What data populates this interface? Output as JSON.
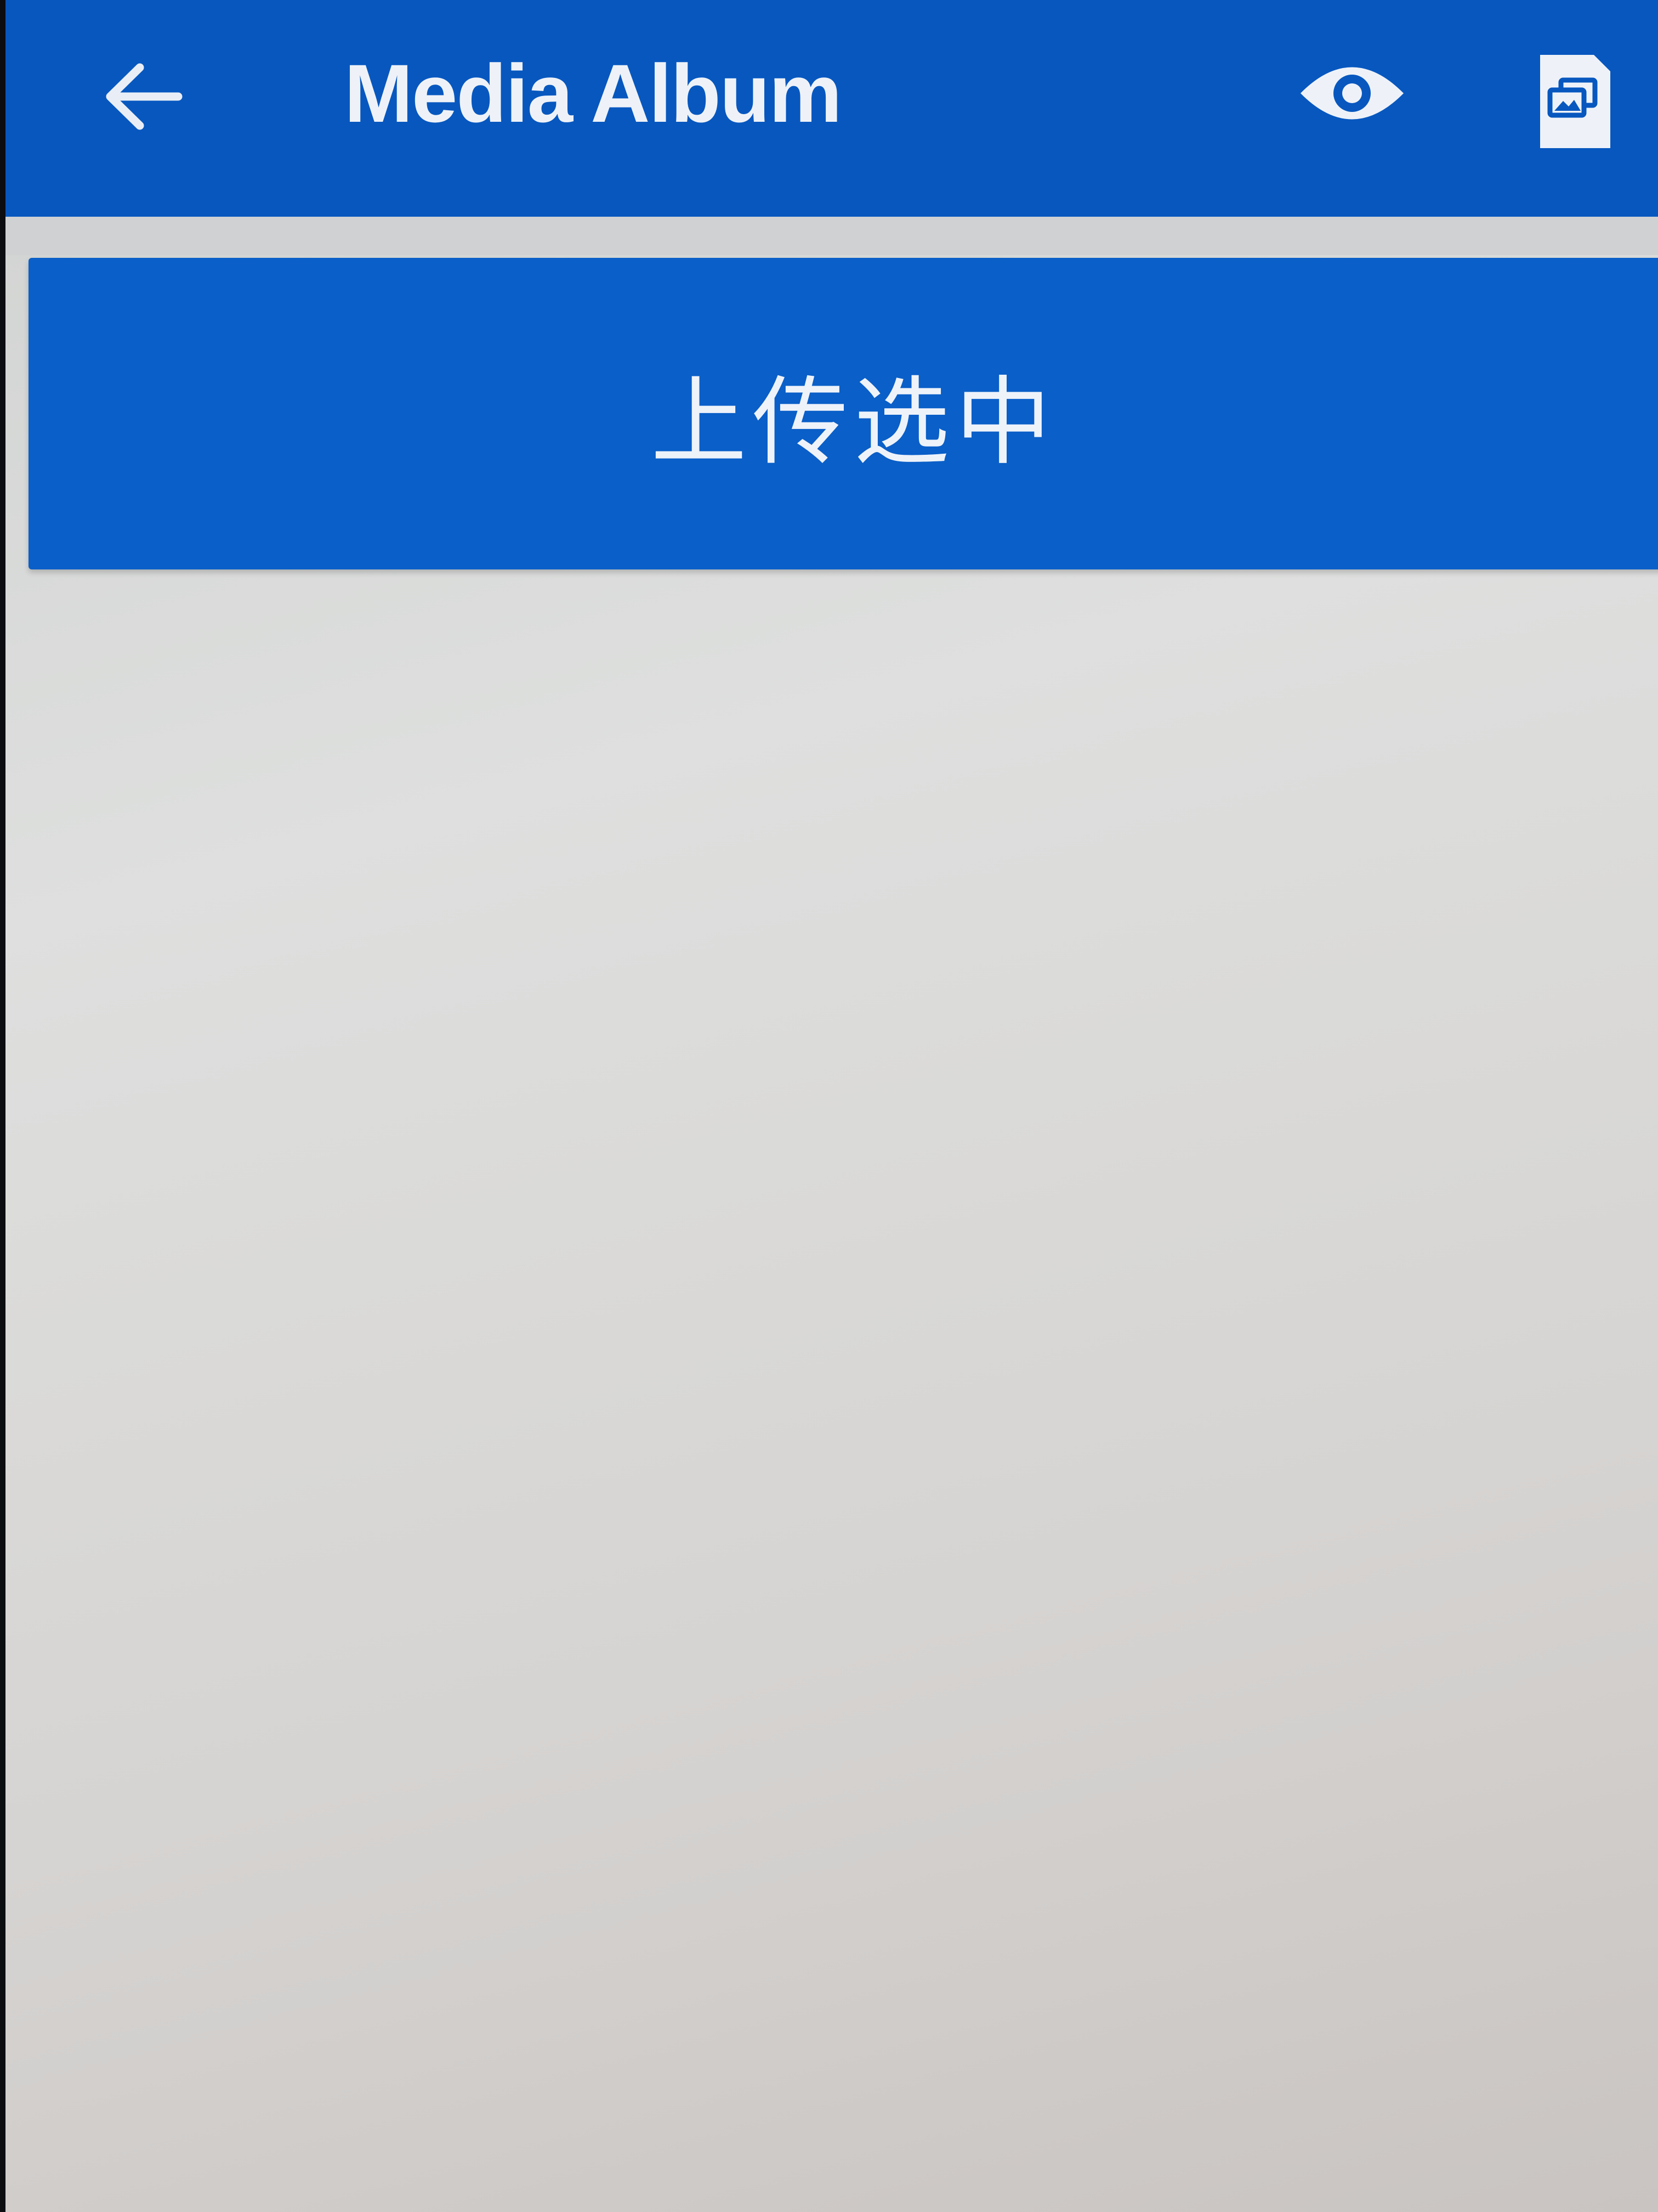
{
  "app_bar": {
    "title": "Media Album",
    "back_icon": "arrow-left-icon",
    "preview_icon": "eye-icon",
    "gallery_icon": "photo-library-icon",
    "background_color": "#0757bf"
  },
  "main": {
    "upload_button_label": "上传选中",
    "upload_button_color": "#0a5fc8"
  }
}
